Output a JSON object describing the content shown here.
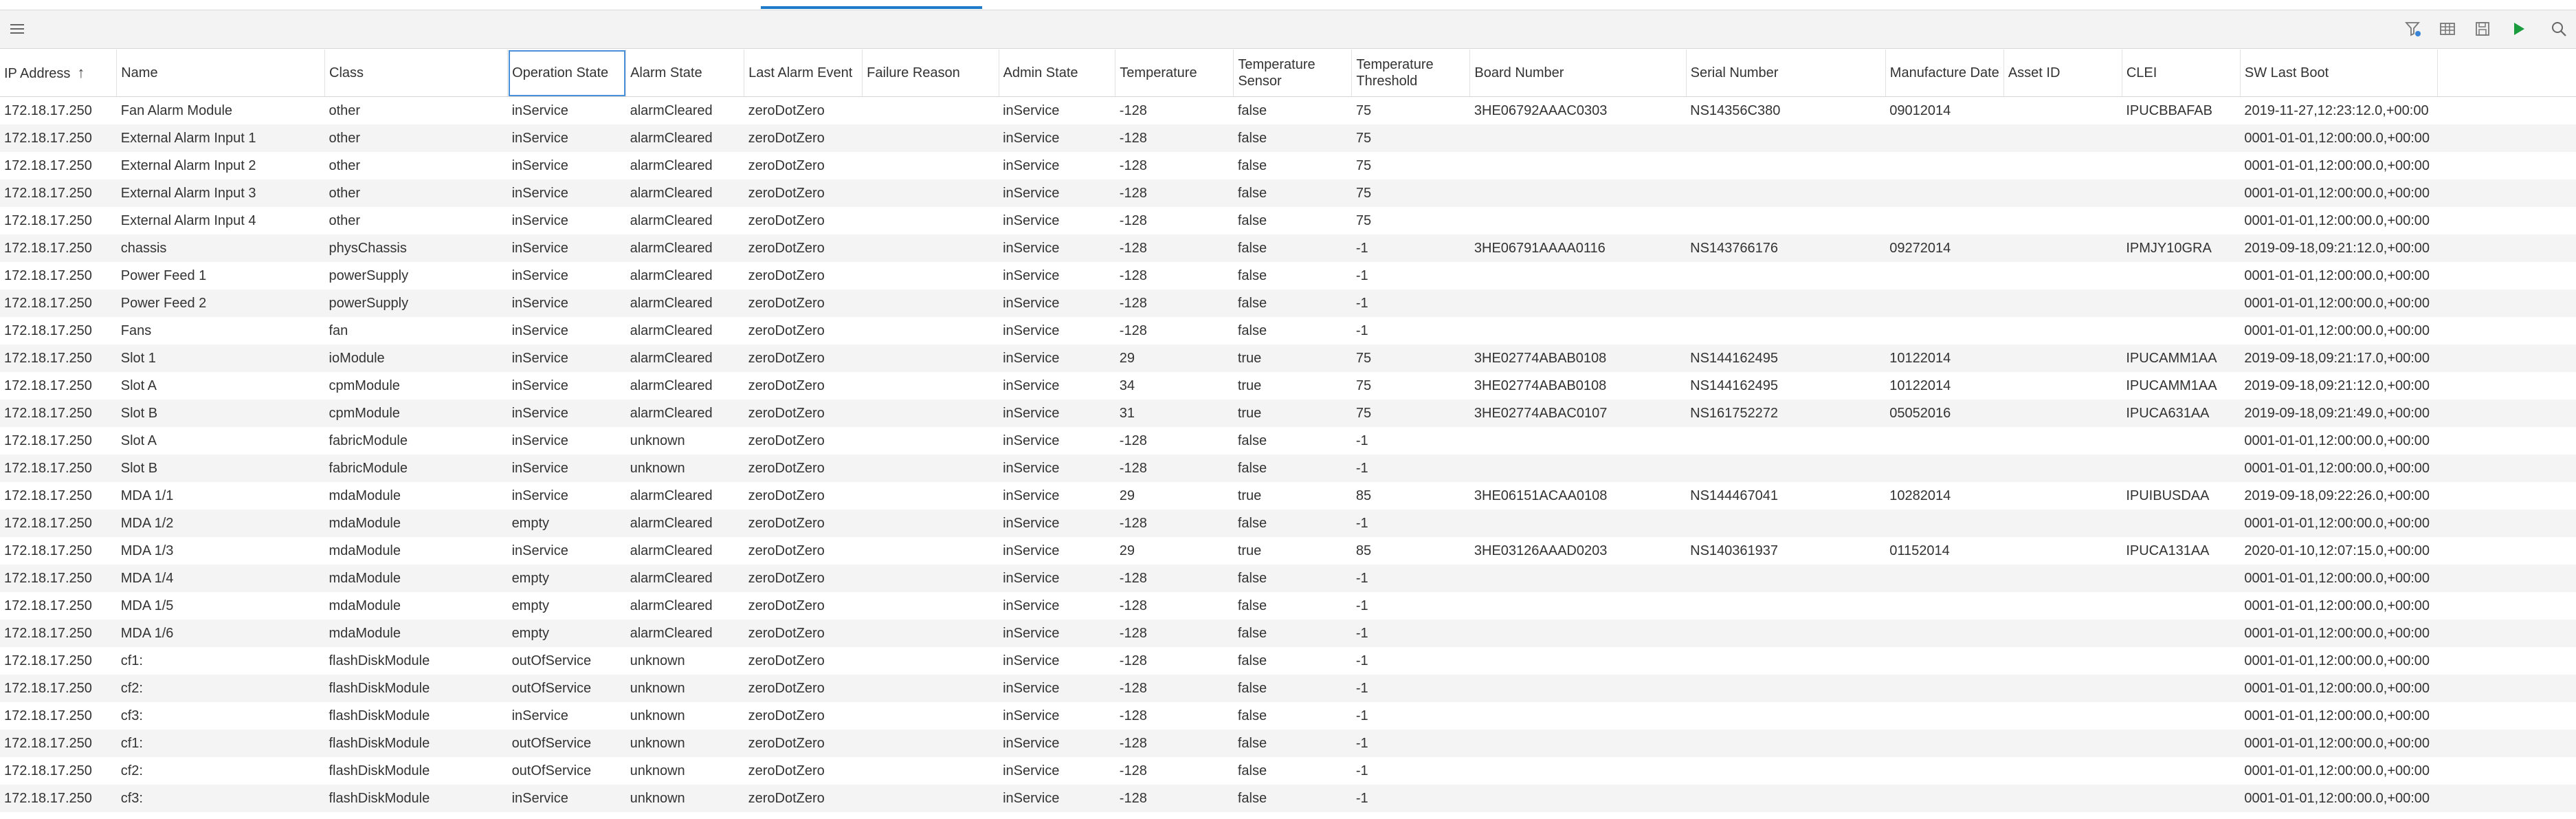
{
  "toolbar": {
    "left_icon": "hamburger-menu-icon",
    "right_icons": [
      "filter-icon",
      "table-view-icon",
      "save-icon",
      "play-icon",
      "search-icon"
    ],
    "play_color": "#1a9c3e"
  },
  "table": {
    "sort_column": "IP Address",
    "sort_direction": "ascending",
    "columns": [
      "IP Address",
      "Name",
      "Class",
      "Operation State",
      "Alarm State",
      "Last Alarm Event",
      "Failure Reason",
      "Admin State",
      "Temperature",
      "Temperature Sensor",
      "Temperature Threshold",
      "Board Number",
      "Serial Number",
      "Manufacture Date",
      "Asset ID",
      "CLEI",
      "SW Last Boot"
    ],
    "rows": [
      [
        "172.18.17.250",
        "Fan Alarm Module",
        "other",
        "inService",
        "alarmCleared",
        "zeroDotZero",
        "",
        "inService",
        "-128",
        "false",
        "75",
        "3HE06792AAAC0303",
        "NS14356C380",
        "09012014",
        "",
        "IPUCBBAFAB",
        "2019-11-27,12:23:12.0,+00:00"
      ],
      [
        "172.18.17.250",
        "External Alarm Input 1",
        "other",
        "inService",
        "alarmCleared",
        "zeroDotZero",
        "",
        "inService",
        "-128",
        "false",
        "75",
        "",
        "",
        "",
        "",
        "",
        "0001-01-01,12:00:00.0,+00:00"
      ],
      [
        "172.18.17.250",
        "External Alarm Input 2",
        "other",
        "inService",
        "alarmCleared",
        "zeroDotZero",
        "",
        "inService",
        "-128",
        "false",
        "75",
        "",
        "",
        "",
        "",
        "",
        "0001-01-01,12:00:00.0,+00:00"
      ],
      [
        "172.18.17.250",
        "External Alarm Input 3",
        "other",
        "inService",
        "alarmCleared",
        "zeroDotZero",
        "",
        "inService",
        "-128",
        "false",
        "75",
        "",
        "",
        "",
        "",
        "",
        "0001-01-01,12:00:00.0,+00:00"
      ],
      [
        "172.18.17.250",
        "External Alarm Input 4",
        "other",
        "inService",
        "alarmCleared",
        "zeroDotZero",
        "",
        "inService",
        "-128",
        "false",
        "75",
        "",
        "",
        "",
        "",
        "",
        "0001-01-01,12:00:00.0,+00:00"
      ],
      [
        "172.18.17.250",
        "chassis",
        "physChassis",
        "inService",
        "alarmCleared",
        "zeroDotZero",
        "",
        "inService",
        "-128",
        "false",
        "-1",
        "3HE06791AAAA0116",
        "NS143766176",
        "09272014",
        "",
        "IPMJY10GRA",
        "2019-09-18,09:21:12.0,+00:00"
      ],
      [
        "172.18.17.250",
        "Power Feed 1",
        "powerSupply",
        "inService",
        "alarmCleared",
        "zeroDotZero",
        "",
        "inService",
        "-128",
        "false",
        "-1",
        "",
        "",
        "",
        "",
        "",
        "0001-01-01,12:00:00.0,+00:00"
      ],
      [
        "172.18.17.250",
        "Power Feed 2",
        "powerSupply",
        "inService",
        "alarmCleared",
        "zeroDotZero",
        "",
        "inService",
        "-128",
        "false",
        "-1",
        "",
        "",
        "",
        "",
        "",
        "0001-01-01,12:00:00.0,+00:00"
      ],
      [
        "172.18.17.250",
        "Fans",
        "fan",
        "inService",
        "alarmCleared",
        "zeroDotZero",
        "",
        "inService",
        "-128",
        "false",
        "-1",
        "",
        "",
        "",
        "",
        "",
        "0001-01-01,12:00:00.0,+00:00"
      ],
      [
        "172.18.17.250",
        "Slot 1",
        "ioModule",
        "inService",
        "alarmCleared",
        "zeroDotZero",
        "",
        "inService",
        "29",
        "true",
        "75",
        "3HE02774ABAB0108",
        "NS144162495",
        "10122014",
        "",
        "IPUCAMM1AA",
        "2019-09-18,09:21:17.0,+00:00"
      ],
      [
        "172.18.17.250",
        "Slot A",
        "cpmModule",
        "inService",
        "alarmCleared",
        "zeroDotZero",
        "",
        "inService",
        "34",
        "true",
        "75",
        "3HE02774ABAB0108",
        "NS144162495",
        "10122014",
        "",
        "IPUCAMM1AA",
        "2019-09-18,09:21:12.0,+00:00"
      ],
      [
        "172.18.17.250",
        "Slot B",
        "cpmModule",
        "inService",
        "alarmCleared",
        "zeroDotZero",
        "",
        "inService",
        "31",
        "true",
        "75",
        "3HE02774ABAC0107",
        "NS161752272",
        "05052016",
        "",
        "IPUCA631AA",
        "2019-09-18,09:21:49.0,+00:00"
      ],
      [
        "172.18.17.250",
        "Slot A",
        "fabricModule",
        "inService",
        "unknown",
        "zeroDotZero",
        "",
        "inService",
        "-128",
        "false",
        "-1",
        "",
        "",
        "",
        "",
        "",
        "0001-01-01,12:00:00.0,+00:00"
      ],
      [
        "172.18.17.250",
        "Slot B",
        "fabricModule",
        "inService",
        "unknown",
        "zeroDotZero",
        "",
        "inService",
        "-128",
        "false",
        "-1",
        "",
        "",
        "",
        "",
        "",
        "0001-01-01,12:00:00.0,+00:00"
      ],
      [
        "172.18.17.250",
        "MDA 1/1",
        "mdaModule",
        "inService",
        "alarmCleared",
        "zeroDotZero",
        "",
        "inService",
        "29",
        "true",
        "85",
        "3HE06151ACAA0108",
        "NS144467041",
        "10282014",
        "",
        "IPUIBUSDAA",
        "2019-09-18,09:22:26.0,+00:00"
      ],
      [
        "172.18.17.250",
        "MDA 1/2",
        "mdaModule",
        "empty",
        "alarmCleared",
        "zeroDotZero",
        "",
        "inService",
        "-128",
        "false",
        "-1",
        "",
        "",
        "",
        "",
        "",
        "0001-01-01,12:00:00.0,+00:00"
      ],
      [
        "172.18.17.250",
        "MDA 1/3",
        "mdaModule",
        "inService",
        "alarmCleared",
        "zeroDotZero",
        "",
        "inService",
        "29",
        "true",
        "85",
        "3HE03126AAAD0203",
        "NS140361937",
        "01152014",
        "",
        "IPUCA131AA",
        "2020-01-10,12:07:15.0,+00:00"
      ],
      [
        "172.18.17.250",
        "MDA 1/4",
        "mdaModule",
        "empty",
        "alarmCleared",
        "zeroDotZero",
        "",
        "inService",
        "-128",
        "false",
        "-1",
        "",
        "",
        "",
        "",
        "",
        "0001-01-01,12:00:00.0,+00:00"
      ],
      [
        "172.18.17.250",
        "MDA 1/5",
        "mdaModule",
        "empty",
        "alarmCleared",
        "zeroDotZero",
        "",
        "inService",
        "-128",
        "false",
        "-1",
        "",
        "",
        "",
        "",
        "",
        "0001-01-01,12:00:00.0,+00:00"
      ],
      [
        "172.18.17.250",
        "MDA 1/6",
        "mdaModule",
        "empty",
        "alarmCleared",
        "zeroDotZero",
        "",
        "inService",
        "-128",
        "false",
        "-1",
        "",
        "",
        "",
        "",
        "",
        "0001-01-01,12:00:00.0,+00:00"
      ],
      [
        "172.18.17.250",
        "cf1:",
        "flashDiskModule",
        "outOfService",
        "unknown",
        "zeroDotZero",
        "",
        "inService",
        "-128",
        "false",
        "-1",
        "",
        "",
        "",
        "",
        "",
        "0001-01-01,12:00:00.0,+00:00"
      ],
      [
        "172.18.17.250",
        "cf2:",
        "flashDiskModule",
        "outOfService",
        "unknown",
        "zeroDotZero",
        "",
        "inService",
        "-128",
        "false",
        "-1",
        "",
        "",
        "",
        "",
        "",
        "0001-01-01,12:00:00.0,+00:00"
      ],
      [
        "172.18.17.250",
        "cf3:",
        "flashDiskModule",
        "inService",
        "unknown",
        "zeroDotZero",
        "",
        "inService",
        "-128",
        "false",
        "-1",
        "",
        "",
        "",
        "",
        "",
        "0001-01-01,12:00:00.0,+00:00"
      ],
      [
        "172.18.17.250",
        "cf1:",
        "flashDiskModule",
        "outOfService",
        "unknown",
        "zeroDotZero",
        "",
        "inService",
        "-128",
        "false",
        "-1",
        "",
        "",
        "",
        "",
        "",
        "0001-01-01,12:00:00.0,+00:00"
      ],
      [
        "172.18.17.250",
        "cf2:",
        "flashDiskModule",
        "outOfService",
        "unknown",
        "zeroDotZero",
        "",
        "inService",
        "-128",
        "false",
        "-1",
        "",
        "",
        "",
        "",
        "",
        "0001-01-01,12:00:00.0,+00:00"
      ],
      [
        "172.18.17.250",
        "cf3:",
        "flashDiskModule",
        "inService",
        "unknown",
        "zeroDotZero",
        "",
        "inService",
        "-128",
        "false",
        "-1",
        "",
        "",
        "",
        "",
        "",
        "0001-01-01,12:00:00.0,+00:00"
      ]
    ]
  }
}
